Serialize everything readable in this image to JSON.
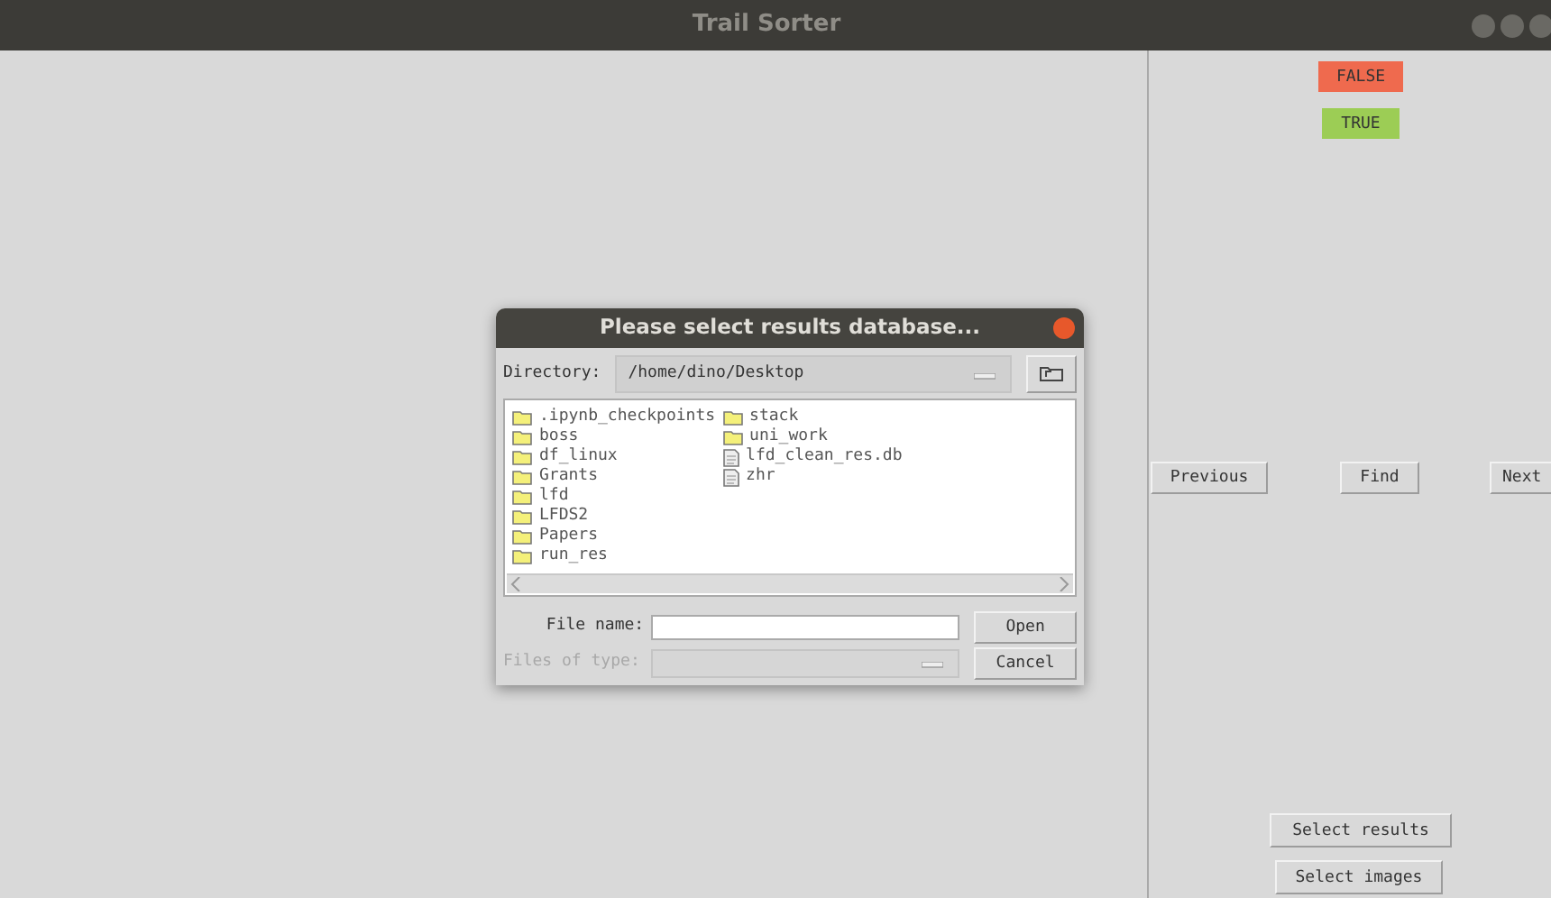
{
  "window": {
    "title": "Trail Sorter"
  },
  "tag_buttons": [
    {
      "label": "FALSE",
      "color": "#ef6a4e"
    },
    {
      "label": "TRUE",
      "color": "#9ccd55"
    }
  ],
  "nav_buttons": [
    "Previous",
    "Find",
    "Next"
  ],
  "bottom_buttons": [
    "Select results",
    "Select images"
  ],
  "dialog": {
    "title": "Please select results database...",
    "directory_label": "Directory:",
    "directory": "/home/dino/Desktop",
    "files": [
      {
        "name": ".ipynb_checkpoints",
        "kind": "folder"
      },
      {
        "name": "boss",
        "kind": "folder"
      },
      {
        "name": "df_linux",
        "kind": "folder"
      },
      {
        "name": "Grants",
        "kind": "folder"
      },
      {
        "name": "lfd",
        "kind": "folder"
      },
      {
        "name": "LFDS2",
        "kind": "folder"
      },
      {
        "name": "Papers",
        "kind": "folder"
      },
      {
        "name": "run_res",
        "kind": "folder"
      },
      {
        "name": "stack",
        "kind": "folder"
      },
      {
        "name": "uni_work",
        "kind": "folder"
      },
      {
        "name": "lfd_clean_res.db",
        "kind": "file"
      },
      {
        "name": "zhr",
        "kind": "file"
      }
    ],
    "file_name_label": "File name:",
    "file_type_label": "Files of type:",
    "file_type_disabled": true,
    "open_button": "Open",
    "cancel_button": "Cancel"
  }
}
